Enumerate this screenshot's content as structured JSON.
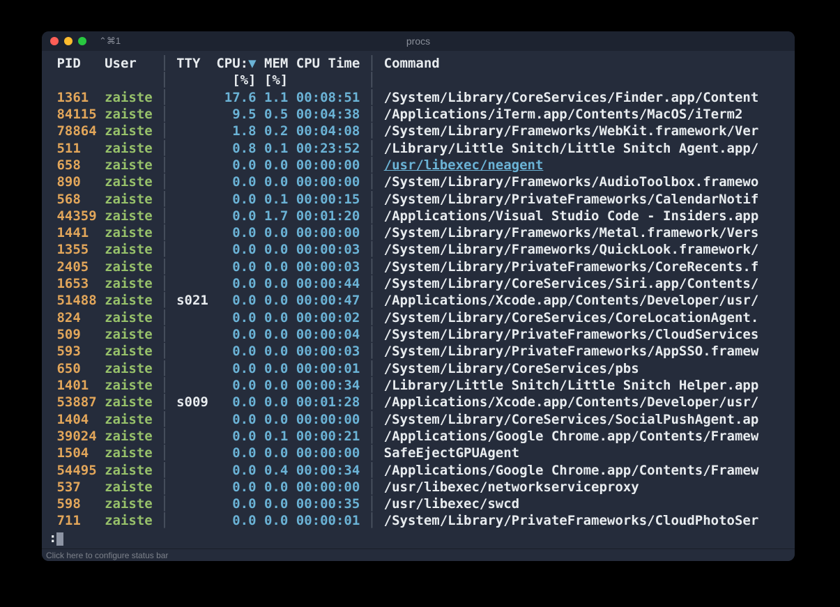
{
  "window": {
    "title": "procs",
    "tab_label": "⌘1",
    "status_bar": "Click here to configure status bar"
  },
  "headers": {
    "pid": "PID",
    "user": "User",
    "tty": "TTY",
    "cpu": "CPU:",
    "sort": "▼",
    "mem": "MEM",
    "cpu_time": "CPU Time",
    "command": "Command",
    "cpu_sub": "[%]",
    "mem_sub": "[%]"
  },
  "prompt": ":",
  "rows": [
    {
      "pid": "1361",
      "user": "zaiste",
      "tty": "",
      "cpu": "17.6",
      "mem": "1.1",
      "time": "00:08:51",
      "cmd": "/System/Library/CoreServices/Finder.app/Content",
      "link": false
    },
    {
      "pid": "84115",
      "user": "zaiste",
      "tty": "",
      "cpu": "9.5",
      "mem": "0.5",
      "time": "00:04:38",
      "cmd": "/Applications/iTerm.app/Contents/MacOS/iTerm2",
      "link": false
    },
    {
      "pid": "78864",
      "user": "zaiste",
      "tty": "",
      "cpu": "1.8",
      "mem": "0.2",
      "time": "00:04:08",
      "cmd": "/System/Library/Frameworks/WebKit.framework/Ver",
      "link": false
    },
    {
      "pid": "511",
      "user": "zaiste",
      "tty": "",
      "cpu": "0.8",
      "mem": "0.1",
      "time": "00:23:52",
      "cmd": "/Library/Little Snitch/Little Snitch Agent.app/",
      "link": false
    },
    {
      "pid": "658",
      "user": "zaiste",
      "tty": "",
      "cpu": "0.0",
      "mem": "0.0",
      "time": "00:00:00",
      "cmd": "/usr/libexec/neagent",
      "link": true
    },
    {
      "pid": "890",
      "user": "zaiste",
      "tty": "",
      "cpu": "0.0",
      "mem": "0.0",
      "time": "00:00:00",
      "cmd": "/System/Library/Frameworks/AudioToolbox.framewo",
      "link": false
    },
    {
      "pid": "568",
      "user": "zaiste",
      "tty": "",
      "cpu": "0.0",
      "mem": "0.1",
      "time": "00:00:15",
      "cmd": "/System/Library/PrivateFrameworks/CalendarNotif",
      "link": false
    },
    {
      "pid": "44359",
      "user": "zaiste",
      "tty": "",
      "cpu": "0.0",
      "mem": "1.7",
      "time": "00:01:20",
      "cmd": "/Applications/Visual Studio Code - Insiders.app",
      "link": false
    },
    {
      "pid": "1441",
      "user": "zaiste",
      "tty": "",
      "cpu": "0.0",
      "mem": "0.0",
      "time": "00:00:00",
      "cmd": "/System/Library/Frameworks/Metal.framework/Vers",
      "link": false
    },
    {
      "pid": "1355",
      "user": "zaiste",
      "tty": "",
      "cpu": "0.0",
      "mem": "0.0",
      "time": "00:00:03",
      "cmd": "/System/Library/Frameworks/QuickLook.framework/",
      "link": false
    },
    {
      "pid": "2405",
      "user": "zaiste",
      "tty": "",
      "cpu": "0.0",
      "mem": "0.0",
      "time": "00:00:03",
      "cmd": "/System/Library/PrivateFrameworks/CoreRecents.f",
      "link": false
    },
    {
      "pid": "1653",
      "user": "zaiste",
      "tty": "",
      "cpu": "0.0",
      "mem": "0.0",
      "time": "00:00:44",
      "cmd": "/System/Library/CoreServices/Siri.app/Contents/",
      "link": false
    },
    {
      "pid": "51488",
      "user": "zaiste",
      "tty": "s021",
      "cpu": "0.0",
      "mem": "0.0",
      "time": "00:00:47",
      "cmd": "/Applications/Xcode.app/Contents/Developer/usr/",
      "link": false
    },
    {
      "pid": "824",
      "user": "zaiste",
      "tty": "",
      "cpu": "0.0",
      "mem": "0.0",
      "time": "00:00:02",
      "cmd": "/System/Library/CoreServices/CoreLocationAgent.",
      "link": false
    },
    {
      "pid": "509",
      "user": "zaiste",
      "tty": "",
      "cpu": "0.0",
      "mem": "0.0",
      "time": "00:00:04",
      "cmd": "/System/Library/PrivateFrameworks/CloudServices",
      "link": false
    },
    {
      "pid": "593",
      "user": "zaiste",
      "tty": "",
      "cpu": "0.0",
      "mem": "0.0",
      "time": "00:00:03",
      "cmd": "/System/Library/PrivateFrameworks/AppSSO.framew",
      "link": false
    },
    {
      "pid": "650",
      "user": "zaiste",
      "tty": "",
      "cpu": "0.0",
      "mem": "0.0",
      "time": "00:00:01",
      "cmd": "/System/Library/CoreServices/pbs",
      "link": false
    },
    {
      "pid": "1401",
      "user": "zaiste",
      "tty": "",
      "cpu": "0.0",
      "mem": "0.0",
      "time": "00:00:34",
      "cmd": "/Library/Little Snitch/Little Snitch Helper.app",
      "link": false
    },
    {
      "pid": "53887",
      "user": "zaiste",
      "tty": "s009",
      "cpu": "0.0",
      "mem": "0.0",
      "time": "00:01:28",
      "cmd": "/Applications/Xcode.app/Contents/Developer/usr/",
      "link": false
    },
    {
      "pid": "1404",
      "user": "zaiste",
      "tty": "",
      "cpu": "0.0",
      "mem": "0.0",
      "time": "00:00:00",
      "cmd": "/System/Library/CoreServices/SocialPushAgent.ap",
      "link": false
    },
    {
      "pid": "39024",
      "user": "zaiste",
      "tty": "",
      "cpu": "0.0",
      "mem": "0.1",
      "time": "00:00:21",
      "cmd": "/Applications/Google Chrome.app/Contents/Framew",
      "link": false
    },
    {
      "pid": "1504",
      "user": "zaiste",
      "tty": "",
      "cpu": "0.0",
      "mem": "0.0",
      "time": "00:00:00",
      "cmd": "SafeEjectGPUAgent",
      "link": false
    },
    {
      "pid": "54495",
      "user": "zaiste",
      "tty": "",
      "cpu": "0.0",
      "mem": "0.4",
      "time": "00:00:34",
      "cmd": "/Applications/Google Chrome.app/Contents/Framew",
      "link": false
    },
    {
      "pid": "537",
      "user": "zaiste",
      "tty": "",
      "cpu": "0.0",
      "mem": "0.0",
      "time": "00:00:00",
      "cmd": "/usr/libexec/networkserviceproxy",
      "link": false
    },
    {
      "pid": "598",
      "user": "zaiste",
      "tty": "",
      "cpu": "0.0",
      "mem": "0.0",
      "time": "00:00:35",
      "cmd": "/usr/libexec/swcd",
      "link": false
    },
    {
      "pid": "711",
      "user": "zaiste",
      "tty": "",
      "cpu": "0.0",
      "mem": "0.0",
      "time": "00:00:01",
      "cmd": "/System/Library/PrivateFrameworks/CloudPhotoSer",
      "link": false
    }
  ]
}
